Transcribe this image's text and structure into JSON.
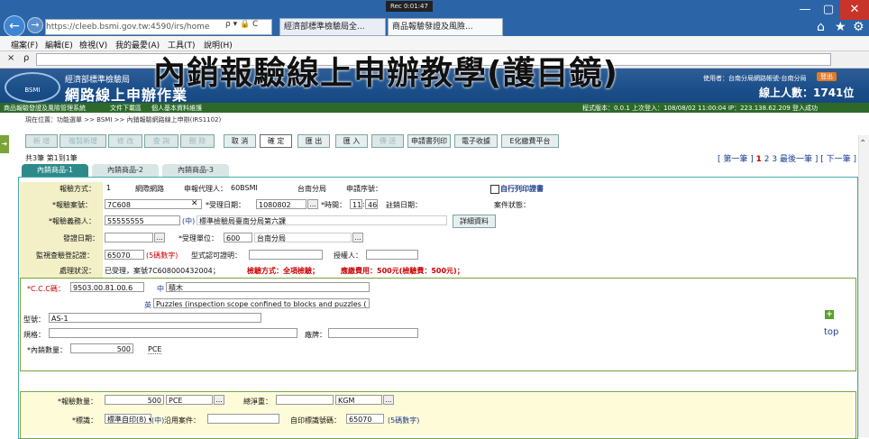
{
  "browser": {
    "url": "https://cleeb.bsmi.gov.tw:4590/irs/home",
    "url_search": "ρ ▾ 🔒 C",
    "tabs": [
      "經濟部標準檢驗局全...",
      "商品報驗發證及風險..."
    ],
    "rec": "Rec 0:01:47",
    "minimize": "—",
    "maximize": "▢",
    "close": "✕",
    "home": "⌂",
    "star": "★",
    "gear": "⚙",
    "back": "←",
    "forward": "→",
    "find_x": "×",
    "find_icon": "ρ"
  },
  "menu": [
    "檔案(F)",
    "編輯(E)",
    "檢視(V)",
    "我的最愛(A)",
    "工具(T)",
    "說明(H)"
  ],
  "overlay_title": "內銷報驗線上申辦教學(護目鏡)",
  "header": {
    "agency": "經濟部標準檢驗局",
    "logo": "BSMI",
    "system": "網路線上申辦作業",
    "user": "使用者：台南分局網路帳號-台南分局",
    "logout": "登出",
    "online": "線上人數：1741位"
  },
  "subnav": [
    "商品報驗發證及風險管理系統",
    "文件下載區",
    "個人基本資料維護"
  ],
  "version": "程式版本：0.0.1 上次登入：108/08/02 11:00:04 IP：223.138.62.209 登入成功",
  "breadcrumb": "現在位置：功能選單 >> BSMI >> 內銷報驗網路線上申辦(IRS1102)",
  "toolbar": [
    "新 增",
    "複製新增",
    "修 改",
    "查 詢",
    "刪 除",
    "取 消",
    "確 定",
    "匯 出",
    "匯 入",
    "傳 送",
    "申請書列印",
    "電子收據",
    "E化繳費平台"
  ],
  "page_count": "共3筆 第1到1筆",
  "pager": {
    "prefix": "[ 第一筆 ]",
    "pages": [
      "1",
      "2",
      "3"
    ],
    "last": "最後一筆 ]",
    "next": "[ 下一筆 ]"
  },
  "product_tabs": [
    "內銷商品-1",
    "內銷商品-2",
    "內銷商品-3"
  ],
  "form": {
    "method_label": "報驗方式：",
    "method_code": "1",
    "method_value": "網際網路",
    "agent_label": "申報代理人：",
    "agent_value": "60BSMI",
    "agent_branch": "台南分局",
    "app_seq_label": "申請序號：",
    "self_print": "自行列印證書",
    "case_no_label": "*報驗案號：",
    "case_no": "7C608",
    "accept_date_label": "*受理日期：",
    "accept_date": "1080802",
    "time_label": "*時間：",
    "time_h": "11",
    "time_m": "46",
    "cancel_date_label": "註銷日期：",
    "case_status_label": "案件狀態：",
    "applicant_label": "*報驗義務人：",
    "applicant_id": "55555555",
    "applicant_prefix": "(中)",
    "applicant_name": "標準檢驗局臺南分局第六課",
    "detail_btn": "詳細資料",
    "issue_date_label": "發證日期：",
    "unit_label": "*受理單位：",
    "unit_code": "600",
    "unit_name": "台南分局",
    "reg_label": "監視查驗登記證：",
    "reg_value": "65070",
    "reg_hint": "(5碼數字)",
    "type_cert_label": "型式認可證明：",
    "authorizer_label": "授權人：",
    "status_label": "處理狀況：",
    "status_text": "已受理，案號7C608000432004；",
    "status_method": "檢驗方式：全項檢驗；",
    "status_fee": "應繳費用：500元(檢驗費：500元)；"
  },
  "item": {
    "ccc_label": "*C.C.C碼：",
    "ccc": "9503.00.81.00.6",
    "zh_label": "中",
    "zh_name": "積木",
    "en_label": "英",
    "en_name": "Puzzles (inspection scope confined to blocks and puzzles (",
    "model_label": "型號：",
    "model": "AS-1",
    "spec_label": "規格：",
    "brand_label": "廠牌：",
    "qty_label": "*內銷數量：",
    "qty": "500",
    "qty_unit": "PCE",
    "add_icon": "+",
    "top_link": "top"
  },
  "bottom": {
    "qty_label": "*報驗數量：",
    "qty": "500",
    "qty_unit": "PCE",
    "net_label": "總淨重：",
    "net_unit": "KGM",
    "mark_label": "*標識：",
    "mark_value": "標準自印(8) ▾",
    "mark_code": "(中)",
    "apply_label": "沿用案件：",
    "self_mark_label": "自印標識號碼：",
    "self_mark": "65070",
    "self_mark_hint": "(5碼數字)"
  }
}
